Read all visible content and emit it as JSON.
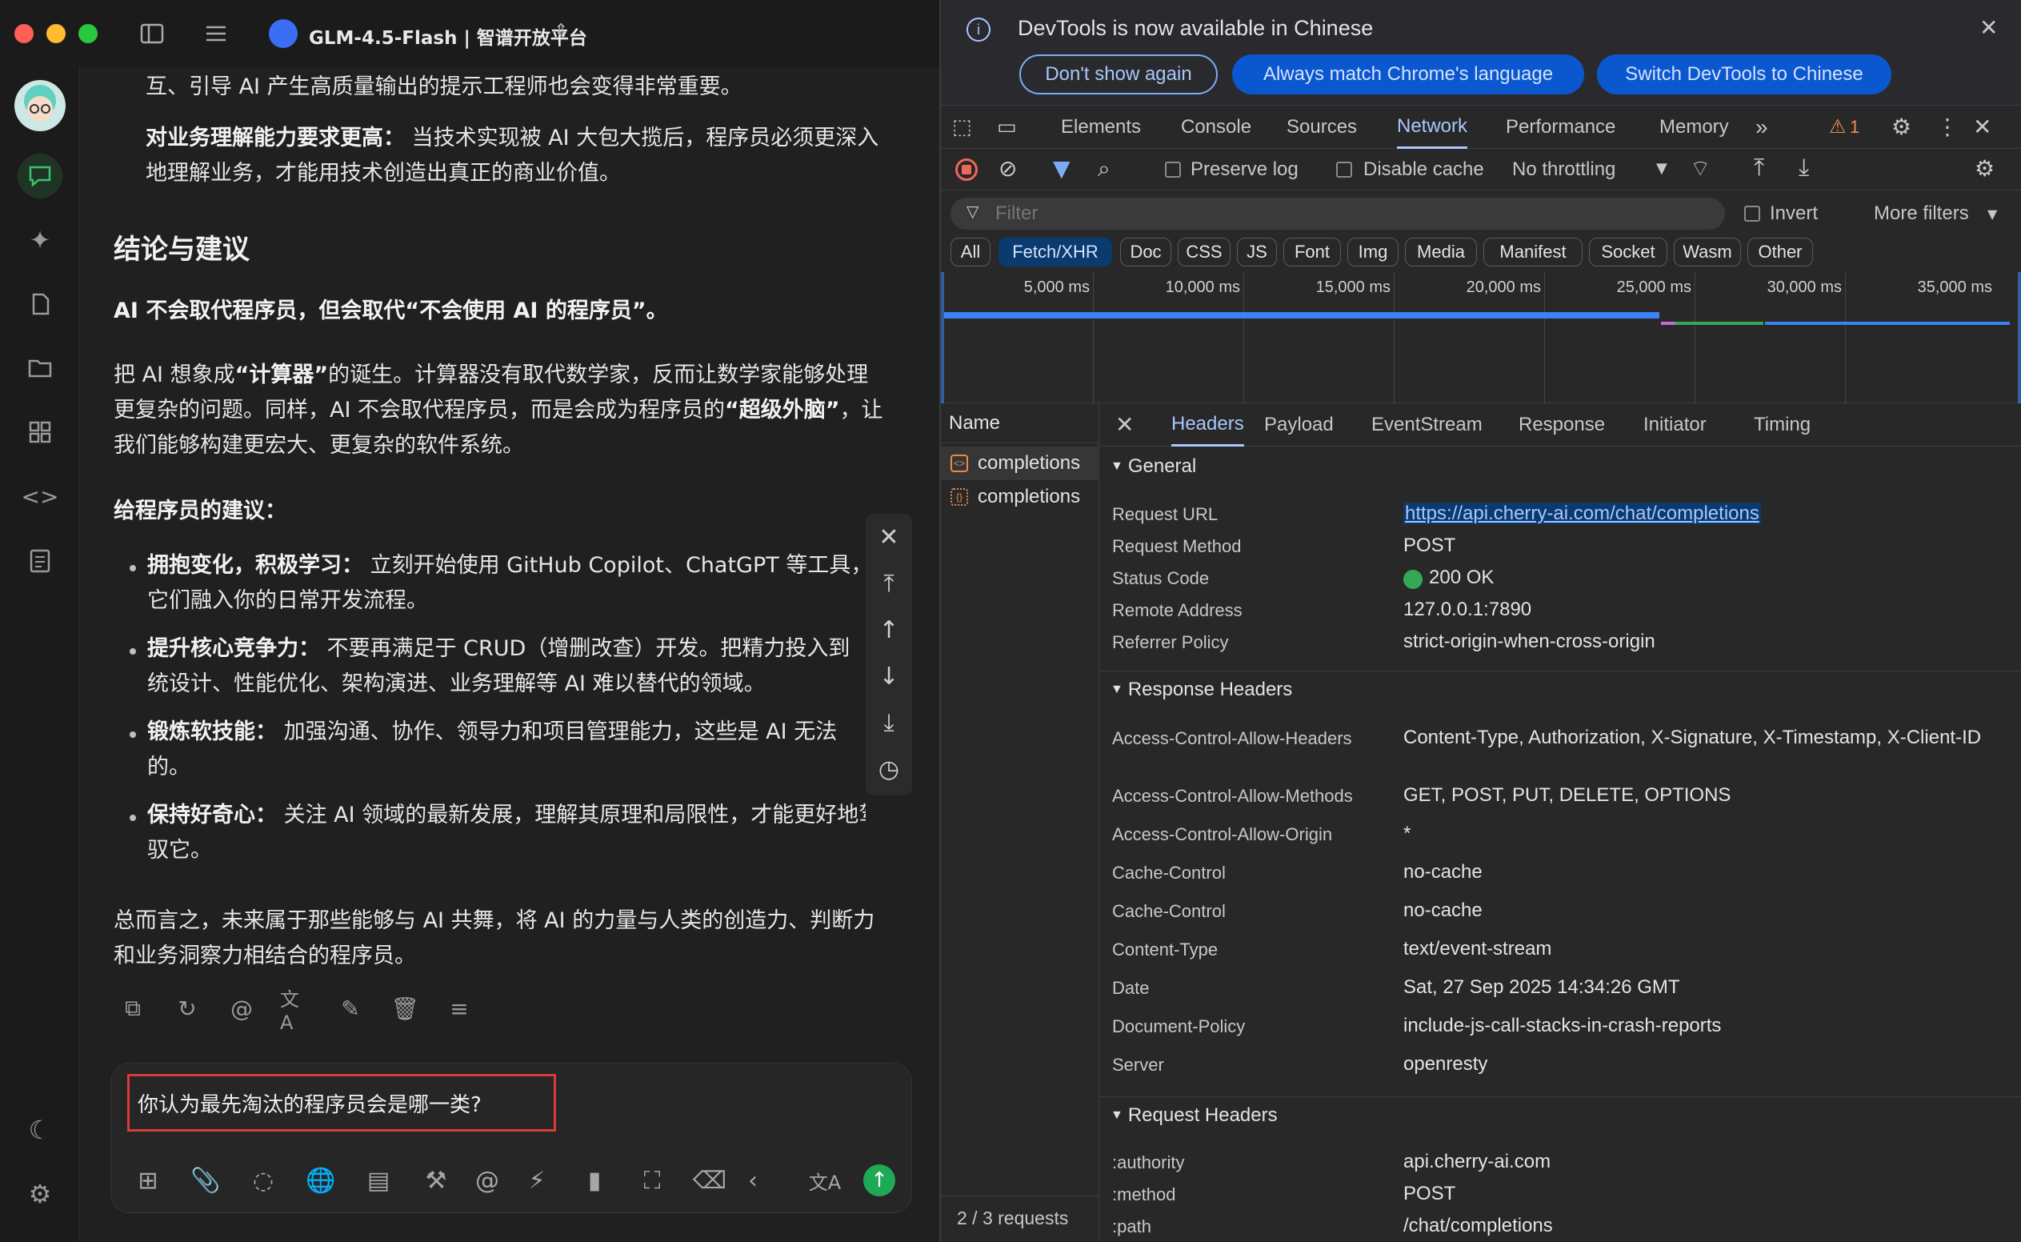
{
  "app": {
    "title": "GLM-4.5-Flash | 智谱开放平台",
    "traffic_colors": [
      "#ff5f57",
      "#febc2e",
      "#28c840"
    ]
  },
  "chat": {
    "p0": "互、引导 AI 产生高质量输出的提示工程师也会变得非常重要。",
    "p1_bold": "对业务理解能力要求更高：",
    "p1_a": "当技术实现被 AI 大包大揽后，程序员必须更深入",
    "p1_b": "地理解业务，才能用技术创造出真正的商业价值。",
    "heading": "结论与建议",
    "conclusion": "AI 不会取代程序员，但会取代“不会使用 AI 的程序员”。",
    "para_a1": "把 AI 想象成",
    "para_a_b1": "“计算器”",
    "para_a2": "的诞生。计算器没有取代数学家，反而让数学家能够处理",
    "para_b": "更复杂的问题。同样，AI 不会取代程序员，而是会成为程序员的",
    "para_b_b": "“超级外脑”",
    "para_b2": "，让",
    "para_c": "我们能够构建更宏大、更复杂的软件系统。",
    "advice_title": "给程序员的建议：",
    "bullets": [
      {
        "bold": "拥抱变化，积极学习：",
        "a": "立刻开始使用 GitHub Copilot、ChatGPT 等工具，",
        "b": "它们融入你的日常开发流程。"
      },
      {
        "bold": "提升核心竞争力：",
        "a": "不要再满足于 CRUD（增删改查）开发。把精力投入到",
        "b": "统设计、性能优化、架构演进、业务理解等 AI 难以替代的领域。"
      },
      {
        "bold": "锻炼软技能：",
        "a": "加强沟通、协作、领导力和项目管理能力，这些是 AI 无法",
        "b": "的。"
      },
      {
        "bold": "保持好奇心：",
        "a": "关注 AI 领域的最新发展，理解其原理和局限性，才能更好地驾",
        "b": "驭它。"
      }
    ],
    "closing_a": "总而言之，未来属于那些能够与 AI 共舞，将 AI 的力量与人类的创造力、判断力",
    "closing_b": "和业务洞察力相结合的程序员。",
    "input_value": "你认为最先淘汰的程序员会是哪一类?"
  },
  "devtools": {
    "notice": "DevTools is now available in Chinese",
    "btn_dont_show": "Don't show again",
    "btn_match": "Always match Chrome's language",
    "btn_switch": "Switch DevTools to Chinese",
    "tabs": [
      "Elements",
      "Console",
      "Sources",
      "Network",
      "Performance",
      "Memory"
    ],
    "warning_count": "1",
    "preserve_log": "Preserve log",
    "disable_cache": "Disable cache",
    "throttling": "No throttling",
    "filter_placeholder": "Filter",
    "invert": "Invert",
    "more_filters": "More filters",
    "types": [
      "All",
      "Fetch/XHR",
      "Doc",
      "CSS",
      "JS",
      "Font",
      "Img",
      "Media",
      "Manifest",
      "Socket",
      "Wasm",
      "Other"
    ],
    "ticks": [
      "5,000 ms",
      "10,000 ms",
      "15,000 ms",
      "20,000 ms",
      "25,000 ms",
      "30,000 ms",
      "35,000 ms"
    ],
    "name_header": "Name",
    "requests": [
      "completions",
      "completions"
    ],
    "footer": "2 / 3 requests",
    "detail_tabs": [
      "Headers",
      "Payload",
      "EventStream",
      "Response",
      "Initiator",
      "Timing"
    ],
    "general_title": "General",
    "general": [
      {
        "k": "Request URL",
        "v": "https://api.cherry-ai.com/chat/completions"
      },
      {
        "k": "Request Method",
        "v": "POST"
      },
      {
        "k": "Status Code",
        "v": "200 OK"
      },
      {
        "k": "Remote Address",
        "v": "127.0.0.1:7890"
      },
      {
        "k": "Referrer Policy",
        "v": "strict-origin-when-cross-origin"
      }
    ],
    "response_title": "Response Headers",
    "response": [
      {
        "k": "Access-Control-Allow-Headers",
        "v": "Content-Type, Authorization, X-Signature, X-Timestamp, X-Client-ID"
      },
      {
        "k": "Access-Control-Allow-Methods",
        "v": "GET, POST, PUT, DELETE, OPTIONS"
      },
      {
        "k": "Access-Control-Allow-Origin",
        "v": "*"
      },
      {
        "k": "Cache-Control",
        "v": "no-cache"
      },
      {
        "k": "Cache-Control",
        "v": "no-cache"
      },
      {
        "k": "Content-Type",
        "v": "text/event-stream"
      },
      {
        "k": "Date",
        "v": "Sat, 27 Sep 2025 14:34:26 GMT"
      },
      {
        "k": "Document-Policy",
        "v": "include-js-call-stacks-in-crash-reports"
      },
      {
        "k": "Server",
        "v": "openresty"
      }
    ],
    "request_title": "Request Headers",
    "request": [
      {
        "k": ":authority",
        "v": "api.cherry-ai.com"
      },
      {
        "k": ":method",
        "v": "POST"
      },
      {
        "k": ":path",
        "v": "/chat/completions"
      }
    ]
  }
}
